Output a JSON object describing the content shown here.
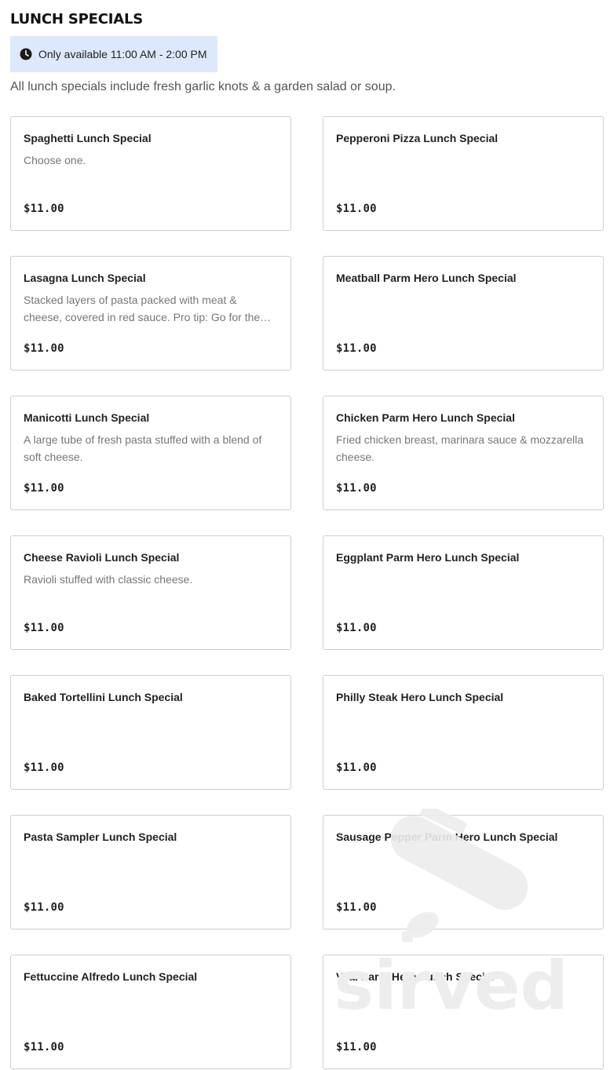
{
  "section": {
    "title": "LUNCH SPECIALS",
    "hours_icon": "clock-icon",
    "hours": "Only available 11:00 AM - 2:00 PM",
    "intro": "All lunch specials include fresh garlic knots & a garden salad or soup."
  },
  "items": [
    {
      "name": "Spaghetti Lunch Special",
      "description": "Choose one.",
      "price": "$11.00"
    },
    {
      "name": "Pepperoni Pizza Lunch Special",
      "description": "",
      "price": "$11.00"
    },
    {
      "name": "Lasagna Lunch Special",
      "description": "Stacked layers of pasta packed with meat & cheese, covered in red sauce. Pro tip: Go for the…",
      "price": "$11.00"
    },
    {
      "name": "Meatball Parm Hero Lunch Special",
      "description": "",
      "price": "$11.00"
    },
    {
      "name": "Manicotti Lunch Special",
      "description": "A large tube of fresh pasta stuffed with a blend of soft cheese.",
      "price": "$11.00"
    },
    {
      "name": "Chicken Parm Hero Lunch Special",
      "description": "Fried chicken breast, marinara sauce & mozzarella cheese.",
      "price": "$11.00"
    },
    {
      "name": "Cheese Ravioli Lunch Special",
      "description": "Ravioli stuffed with classic cheese.",
      "price": "$11.00"
    },
    {
      "name": "Eggplant Parm Hero Lunch Special",
      "description": "",
      "price": "$11.00"
    },
    {
      "name": "Baked Tortellini Lunch Special",
      "description": "",
      "price": "$11.00"
    },
    {
      "name": "Philly Steak Hero Lunch Special",
      "description": "",
      "price": "$11.00"
    },
    {
      "name": "Pasta Sampler Lunch Special",
      "description": "",
      "price": "$11.00"
    },
    {
      "name": "Sausage Pepper Parm Hero Lunch Special",
      "description": "",
      "price": "$11.00"
    },
    {
      "name": "Fettuccine Alfredo Lunch Special",
      "description": "",
      "price": "$11.00"
    },
    {
      "name": "Veal Parm Hero Lunch Special",
      "description": "",
      "price": "$11.00"
    }
  ],
  "watermark": {
    "text": "sirved",
    "icon": "knife-fork-spoon-logo"
  },
  "colors": {
    "badge_bg": "#dde9fa",
    "border": "#cfcfcf",
    "muted": "#777777"
  }
}
